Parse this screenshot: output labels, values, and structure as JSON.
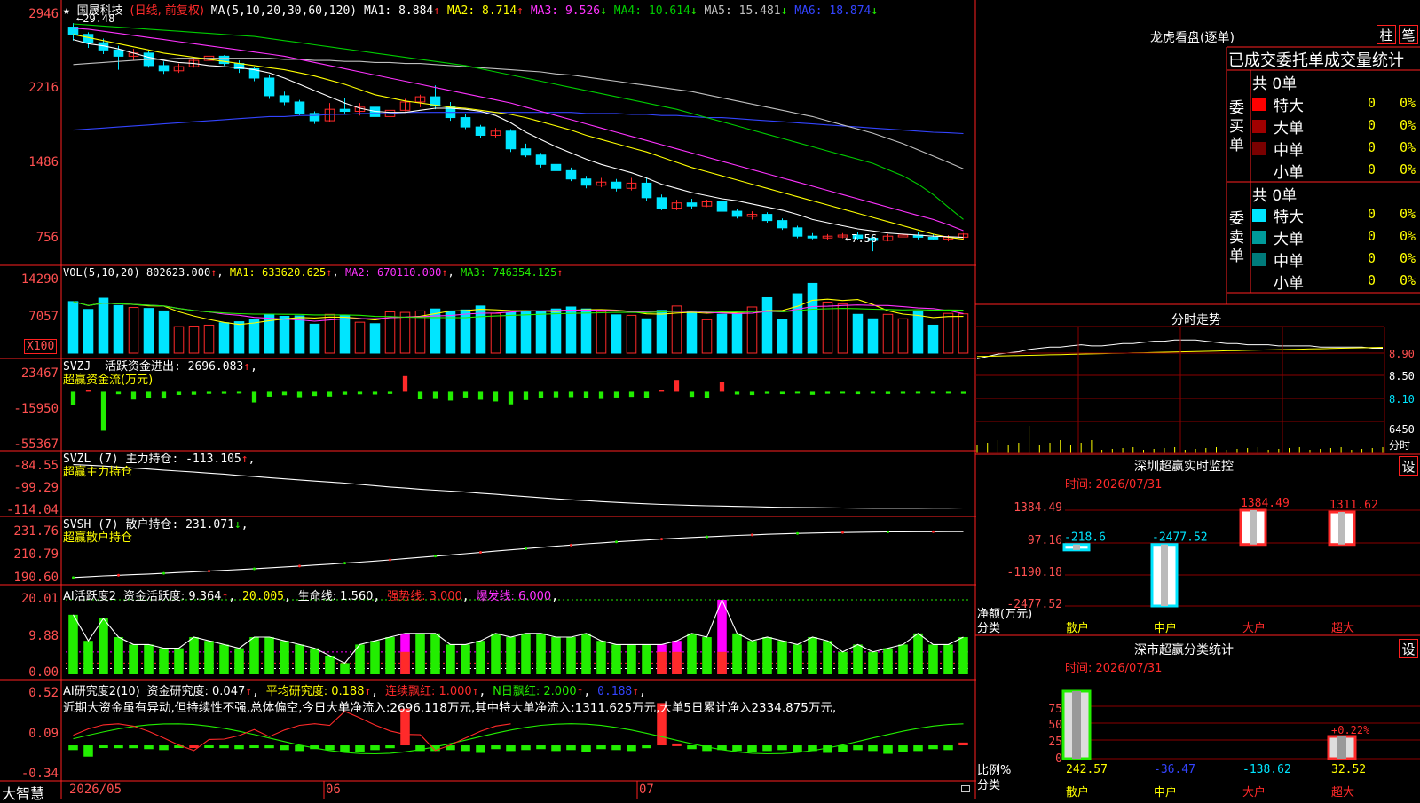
{
  "colors": {
    "up": "#ff2a2a",
    "down": "#00e5ff",
    "grid": "#8b0000",
    "border": "#ff2020",
    "axis": "#ff5050",
    "ma5": "#ffffff",
    "ma10": "#ffff00",
    "ma20": "#ff33ff",
    "ma30": "#00cc00",
    "ma60": "#c0c0c0",
    "ma120": "#3344ff",
    "green": "#22ee00",
    "magenta": "#ff00ff",
    "white": "#ffffff",
    "cyan": "#00e5ff"
  },
  "top_left": {
    "star": "★",
    "name": "国晟科技",
    "mode": "(日线, 前复权)",
    "ma_label": "MA(5,10,20,30,60,120)",
    "ma1": "MA1: 8.884",
    "ma2": "MA2: 8.714",
    "ma3": "MA3: 9.526",
    "ma4": "MA4: 10.614",
    "ma5": "MA5: 15.481",
    "ma6": "MA6: 18.874",
    "high_mark": "←29.48",
    "low_mark": "←7.56"
  },
  "price_axis": [
    "2946",
    "2216",
    "1486",
    "756"
  ],
  "vol_panel": {
    "title": "VOL(5,10,20)",
    "v": "802623.000",
    "ma1": "MA1: 633620.625",
    "ma2": "MA2: 670110.000",
    "ma3": "MA3: 746354.125",
    "axis": [
      "14290",
      "7057"
    ],
    "unit": "X100"
  },
  "svzj_panel": {
    "title": "SVZJ",
    "l1": "活跃资金进出: 2696.083",
    "l2": "超赢资金流(万元)",
    "axis": [
      "23467",
      "-15950",
      "-55367"
    ]
  },
  "svzl_panel": {
    "title": "SVZL (7)",
    "l1": "主力持仓: -113.105",
    "l2": "超赢主力持仓",
    "axis": [
      "-84.55",
      "-99.29",
      "-114.04"
    ]
  },
  "svsh_panel": {
    "title": "SVSH (7)",
    "l1": "散户持仓: 231.071",
    "l2": "超赢散户持仓",
    "axis": [
      "231.76",
      "210.79",
      "190.60"
    ]
  },
  "ai1_panel": {
    "title": "AI活跃度2",
    "l1": "资金活跃度: 9.364",
    "l2": "20.005",
    "l3": "生命线: 1.560",
    "l4": "强势线: 3.000",
    "l5": "爆发线: 6.000",
    "axis": [
      "20.01",
      "9.88",
      "0.00"
    ]
  },
  "ai2_panel": {
    "title": "AI研究度2(10)",
    "l1": "资金研究度: 0.047",
    "l2": "平均研究度: 0.188",
    "l3": "连续飘红: 1.000",
    "l4": "N日飘红: 2.000",
    "l5": "0.188",
    "comment": "近期大资金虽有异动,但持续性不强,总体偏空,今日大单净流入:2696.118万元,其中特大单净流入:1311.625万元,大单5日累计净入2334.875万元,",
    "axis": [
      "0.52",
      "0.09",
      "-0.34"
    ]
  },
  "date_axis": [
    "2026/05",
    "06",
    "07"
  ],
  "brand": "大智慧",
  "lhb": {
    "title": "龙虎看盘(逐单)",
    "btn1": "柱",
    "btn2": "笔",
    "subtitle": "已成交委托单成交量统计",
    "buy_label": "委买单",
    "sell_label": "委卖单",
    "buy_total": "共 0单",
    "sell_total": "共 0单",
    "rows": [
      {
        "name": "特大",
        "count": "0",
        "pct": "0%"
      },
      {
        "name": "大单",
        "count": "0",
        "pct": "0%"
      },
      {
        "name": "中单",
        "count": "0",
        "pct": "0%"
      },
      {
        "name": "小单",
        "count": "0",
        "pct": "0%"
      }
    ]
  },
  "intraday": {
    "title": "分时走势",
    "axis": [
      "8.90",
      "8.50",
      "8.10",
      "6450",
      "分时"
    ]
  },
  "monitor": {
    "title": "深圳超赢实时监控",
    "btn": "设",
    "date": "时间: 2026/07/31",
    "ylabel": "净额(万元)",
    "xlabel": "分类",
    "axis": [
      "1384.49",
      "97.16",
      "-1190.18",
      "-2477.52"
    ],
    "categories": [
      "散户",
      "中户",
      "大户",
      "超大"
    ],
    "values": [
      -218.6,
      -2477.52,
      1384.49,
      1311.62
    ],
    "value_labels": [
      "-218.6",
      "-2477.52",
      "1384.49",
      "1311.62"
    ]
  },
  "stats": {
    "title": "深市超赢分类统计",
    "btn": "设",
    "date": "时间: 2026/07/31",
    "ylabel": "比例%",
    "xlabel": "分类",
    "axis": [
      "75",
      "50",
      "25",
      "0"
    ],
    "categories": [
      "散户",
      "中户",
      "大户",
      "超大"
    ],
    "values": [
      242.57,
      -36.47,
      -138.62,
      32.52
    ],
    "value_labels": [
      "242.57",
      "-36.47",
      "-138.62",
      "32.52"
    ],
    "extra_label": "+0.22%"
  },
  "chart_data": {
    "type": "bar",
    "title": "国晟科技 日线 前复权",
    "candles": [
      [
        29.1,
        29.48,
        27.8,
        28.4
      ],
      [
        28.4,
        28.6,
        27.1,
        27.6
      ],
      [
        27.6,
        28.0,
        26.5,
        26.9
      ],
      [
        26.9,
        27.3,
        25.0,
        26.3
      ],
      [
        26.3,
        27.0,
        25.9,
        26.6
      ],
      [
        26.6,
        26.8,
        25.2,
        25.4
      ],
      [
        25.4,
        25.8,
        24.6,
        24.9
      ],
      [
        24.9,
        25.6,
        24.7,
        25.3
      ],
      [
        25.3,
        26.1,
        25.2,
        25.9
      ],
      [
        25.9,
        26.5,
        25.8,
        26.3
      ],
      [
        26.3,
        26.4,
        25.4,
        25.6
      ],
      [
        25.6,
        25.9,
        24.7,
        25.1
      ],
      [
        25.1,
        25.3,
        23.9,
        24.2
      ],
      [
        24.2,
        24.5,
        22.2,
        22.5
      ],
      [
        22.5,
        22.9,
        21.6,
        21.9
      ],
      [
        21.9,
        22.1,
        20.6,
        20.8
      ],
      [
        20.8,
        21.0,
        19.8,
        20.1
      ],
      [
        20.1,
        21.8,
        20.0,
        21.2
      ],
      [
        21.2,
        22.3,
        20.8,
        21.0
      ],
      [
        21.0,
        21.8,
        20.6,
        21.4
      ],
      [
        21.4,
        21.6,
        20.2,
        20.5
      ],
      [
        20.5,
        21.5,
        20.4,
        21.1
      ],
      [
        21.1,
        22.2,
        21.0,
        21.9
      ],
      [
        21.9,
        22.6,
        21.4,
        22.4
      ],
      [
        22.4,
        23.5,
        21.2,
        21.5
      ],
      [
        21.5,
        21.9,
        20.1,
        20.4
      ],
      [
        20.4,
        20.7,
        19.3,
        19.5
      ],
      [
        19.5,
        19.7,
        18.4,
        18.7
      ],
      [
        18.7,
        19.4,
        18.5,
        19.1
      ],
      [
        19.1,
        19.3,
        17.1,
        17.4
      ],
      [
        17.4,
        17.9,
        16.6,
        16.8
      ],
      [
        16.8,
        17.0,
        15.6,
        15.9
      ],
      [
        15.9,
        16.2,
        15.0,
        15.3
      ],
      [
        15.3,
        15.6,
        14.3,
        14.5
      ],
      [
        14.5,
        14.8,
        13.6,
        13.9
      ],
      [
        13.9,
        14.6,
        13.7,
        14.2
      ],
      [
        14.2,
        14.5,
        13.3,
        13.6
      ],
      [
        13.6,
        14.6,
        13.4,
        14.1
      ],
      [
        14.1,
        14.6,
        12.4,
        12.7
      ],
      [
        12.7,
        13.0,
        11.5,
        11.7
      ],
      [
        11.7,
        12.5,
        11.5,
        12.2
      ],
      [
        12.2,
        12.6,
        11.6,
        11.9
      ],
      [
        11.9,
        12.5,
        11.8,
        12.3
      ],
      [
        12.3,
        12.6,
        11.2,
        11.4
      ],
      [
        11.4,
        11.6,
        10.7,
        10.9
      ],
      [
        10.9,
        11.4,
        10.6,
        11.1
      ],
      [
        11.1,
        11.3,
        10.3,
        10.5
      ],
      [
        10.5,
        10.7,
        9.6,
        9.8
      ],
      [
        9.8,
        10.0,
        8.8,
        9.0
      ],
      [
        9.0,
        9.3,
        8.7,
        8.9
      ],
      [
        8.9,
        9.2,
        8.6,
        9.0
      ],
      [
        9.0,
        9.3,
        8.8,
        9.1
      ],
      [
        9.1,
        9.4,
        8.6,
        8.8
      ],
      [
        8.8,
        9.0,
        7.56,
        8.6
      ],
      [
        8.6,
        9.2,
        8.5,
        9.0
      ],
      [
        9.0,
        9.5,
        8.9,
        9.1
      ],
      [
        9.1,
        9.4,
        8.7,
        8.9
      ],
      [
        8.9,
        9.2,
        8.6,
        8.8
      ],
      [
        8.8,
        9.1,
        8.5,
        8.9
      ],
      [
        8.9,
        9.3,
        8.6,
        9.2
      ]
    ],
    "ma5": [
      27.9,
      27.5,
      27.3,
      27.0,
      26.6,
      26.2,
      25.9,
      25.7,
      25.6,
      25.4,
      25.3,
      25.2,
      25.0,
      24.7,
      24.2,
      23.6,
      23.0,
      22.4,
      21.8,
      21.3,
      21.0,
      20.9,
      20.9,
      21.1,
      21.3,
      21.3,
      21.2,
      21.0,
      20.6,
      19.9,
      19.0,
      18.3,
      17.6,
      17.0,
      16.4,
      15.9,
      15.5,
      15.1,
      14.6,
      14.0,
      13.6,
      13.2,
      12.9,
      12.6,
      12.4,
      12.1,
      11.8,
      11.5,
      11.1,
      10.6,
      10.3,
      10.0,
      9.7,
      9.5,
      9.3,
      9.2,
      9.1,
      9.0,
      8.95,
      8.88
    ],
    "ma10": [
      28.4,
      28.1,
      27.8,
      27.5,
      27.2,
      26.9,
      26.6,
      26.4,
      26.2,
      26.0,
      25.8,
      25.6,
      25.4,
      25.2,
      25.0,
      24.7,
      24.4,
      24.0,
      23.6,
      23.1,
      22.6,
      22.3,
      22.0,
      21.8,
      21.6,
      21.4,
      21.3,
      21.1,
      20.9,
      20.7,
      20.4,
      20.0,
      19.6,
      19.2,
      18.7,
      18.3,
      17.9,
      17.5,
      17.1,
      16.6,
      16.1,
      15.6,
      15.2,
      14.8,
      14.4,
      14.0,
      13.6,
      13.2,
      12.8,
      12.4,
      12.0,
      11.6,
      11.2,
      10.8,
      10.4,
      10.0,
      9.6,
      9.2,
      8.9,
      8.71
    ],
    "ma20": [
      29.0,
      28.9,
      28.7,
      28.5,
      28.3,
      28.1,
      27.9,
      27.7,
      27.5,
      27.3,
      27.1,
      26.9,
      26.7,
      26.5,
      26.3,
      26.0,
      25.7,
      25.4,
      25.1,
      24.8,
      24.5,
      24.2,
      23.9,
      23.6,
      23.3,
      23.0,
      22.7,
      22.4,
      22.1,
      21.8,
      21.4,
      21.0,
      20.6,
      20.2,
      19.8,
      19.4,
      19.0,
      18.6,
      18.2,
      17.8,
      17.4,
      17.0,
      16.6,
      16.2,
      15.8,
      15.4,
      15.0,
      14.6,
      14.2,
      13.8,
      13.4,
      13.0,
      12.6,
      12.2,
      11.8,
      11.4,
      11.0,
      10.6,
      10.1,
      9.53
    ],
    "ma30": [
      29.4,
      29.3,
      29.2,
      29.1,
      29.0,
      28.9,
      28.8,
      28.7,
      28.6,
      28.5,
      28.4,
      28.3,
      28.2,
      28.0,
      27.8,
      27.6,
      27.4,
      27.2,
      27.0,
      26.8,
      26.6,
      26.4,
      26.2,
      26.0,
      25.8,
      25.6,
      25.4,
      25.1,
      24.8,
      24.5,
      24.2,
      23.9,
      23.6,
      23.3,
      23.0,
      22.7,
      22.4,
      22.1,
      21.8,
      21.5,
      21.2,
      20.8,
      20.4,
      20.0,
      19.6,
      19.2,
      18.8,
      18.4,
      18.0,
      17.6,
      17.2,
      16.8,
      16.4,
      16.0,
      15.4,
      14.8,
      14.0,
      13.0,
      11.8,
      10.61
    ],
    "ma60": [
      25.5,
      25.6,
      25.7,
      25.8,
      25.9,
      26.0,
      26.0,
      26.1,
      26.1,
      26.1,
      26.1,
      26.1,
      26.1,
      26.1,
      26.0,
      26.0,
      25.9,
      25.9,
      25.8,
      25.8,
      25.7,
      25.7,
      25.6,
      25.6,
      25.5,
      25.4,
      25.3,
      25.2,
      25.1,
      25.0,
      24.9,
      24.8,
      24.6,
      24.5,
      24.3,
      24.1,
      23.9,
      23.7,
      23.5,
      23.3,
      23.1,
      22.9,
      22.6,
      22.3,
      22.0,
      21.7,
      21.4,
      21.1,
      20.8,
      20.5,
      20.1,
      19.7,
      19.3,
      18.9,
      18.4,
      17.9,
      17.3,
      16.7,
      16.1,
      15.48
    ],
    "ma120": [
      19.2,
      19.3,
      19.4,
      19.5,
      19.6,
      19.7,
      19.8,
      19.9,
      20.0,
      20.1,
      20.2,
      20.3,
      20.4,
      20.5,
      20.5,
      20.6,
      20.6,
      20.7,
      20.7,
      20.8,
      20.8,
      20.8,
      20.9,
      20.9,
      20.9,
      20.9,
      20.9,
      20.9,
      20.9,
      20.9,
      20.9,
      20.9,
      20.9,
      20.9,
      20.8,
      20.8,
      20.8,
      20.7,
      20.7,
      20.6,
      20.6,
      20.5,
      20.4,
      20.4,
      20.3,
      20.2,
      20.1,
      20.0,
      19.9,
      19.8,
      19.7,
      19.6,
      19.5,
      19.4,
      19.3,
      19.2,
      19.1,
      19.0,
      18.95,
      18.87
    ],
    "volume": [
      10500,
      8900,
      11200,
      9700,
      9300,
      9100,
      8600,
      5400,
      5500,
      5700,
      6200,
      6400,
      6900,
      7900,
      7500,
      7600,
      5900,
      7900,
      7700,
      6300,
      6000,
      8400,
      8300,
      8600,
      9000,
      8600,
      8800,
      9600,
      8100,
      8300,
      8400,
      8500,
      9000,
      9400,
      9000,
      8500,
      7800,
      7700,
      7000,
      8700,
      9600,
      8600,
      6800,
      7900,
      8000,
      9400,
      11300,
      6900,
      12100,
      14200,
      10400,
      10000,
      7900,
      7000,
      7900,
      7000,
      8600,
      5700,
      8100,
      8000
    ],
    "svzj": [
      -14000,
      1800,
      -40000,
      -2500,
      -8000,
      -6800,
      -7000,
      -3200,
      -3000,
      -2100,
      -2000,
      -1800,
      -11000,
      -5000,
      -3500,
      -5600,
      -4300,
      -4900,
      -3000,
      -2600,
      -2800,
      -2200,
      16000,
      -7800,
      -7400,
      -9100,
      -5900,
      -8200,
      -10000,
      -13000,
      -8500,
      -6100,
      -5700,
      -5500,
      -6400,
      -7400,
      -5900,
      -5200,
      -6000,
      2000,
      12000,
      -5200,
      -6800,
      10000,
      -2800,
      -3300,
      -2000,
      -2400,
      -1800,
      -3100,
      -2000,
      -1500,
      -2400,
      -1700,
      -2200,
      -1900,
      -1600,
      -1700,
      -1500,
      -2000
    ],
    "svzl": [
      -86.0,
      -86.4,
      -86.9,
      -87.5,
      -88.2,
      -88.8,
      -89.5,
      -90.1,
      -90.7,
      -91.4,
      -92.0,
      -92.8,
      -93.5,
      -94.2,
      -94.9,
      -95.6,
      -96.3,
      -96.9,
      -97.6,
      -98.4,
      -99.2,
      -100.0,
      -100.7,
      -101.4,
      -102.0,
      -102.6,
      -103.2,
      -103.9,
      -104.6,
      -105.3,
      -106.0,
      -106.7,
      -107.4,
      -108.0,
      -108.5,
      -109.1,
      -109.6,
      -110.1,
      -110.5,
      -110.9,
      -111.2,
      -111.5,
      -111.7,
      -111.9,
      -112.1,
      -112.3,
      -112.5,
      -112.7,
      -112.8,
      -112.9,
      -113.0,
      -113.1,
      -113.2,
      -113.3,
      -113.3,
      -113.3,
      -113.3,
      -113.2,
      -113.2,
      -113.1
    ],
    "svsh": [
      190.9,
      191.6,
      192.3,
      192.9,
      193.4,
      194.0,
      194.6,
      195.3,
      195.9,
      196.5,
      197.2,
      197.9,
      198.6,
      199.4,
      200.2,
      201.0,
      201.8,
      202.6,
      203.5,
      204.4,
      205.3,
      206.3,
      207.4,
      208.5,
      209.6,
      210.7,
      211.8,
      212.9,
      214.0,
      215.1,
      216.2,
      217.3,
      218.3,
      219.3,
      220.3,
      221.2,
      222.1,
      222.9,
      223.7,
      224.5,
      225.2,
      225.9,
      226.5,
      227.1,
      227.7,
      228.2,
      228.7,
      229.1,
      229.5,
      229.8,
      230.1,
      230.3,
      230.5,
      230.7,
      230.8,
      230.9,
      231.0,
      231.0,
      231.1,
      231.07
    ],
    "ai_active": [
      16,
      9,
      15,
      10,
      8,
      8,
      7,
      7,
      10,
      9,
      8,
      7,
      10,
      10,
      9,
      8,
      7,
      5,
      3,
      8,
      9,
      10,
      11,
      11,
      11,
      8,
      8,
      9,
      11,
      10,
      11,
      11,
      10,
      10,
      11,
      9,
      8,
      8,
      8,
      8,
      9,
      11,
      10,
      20,
      11,
      9,
      10,
      9,
      8,
      10,
      9,
      6,
      8,
      6,
      7,
      8,
      11,
      8,
      8,
      10
    ],
    "ai_highlight": [
      false,
      false,
      false,
      false,
      false,
      false,
      false,
      false,
      false,
      false,
      false,
      false,
      false,
      false,
      false,
      false,
      false,
      false,
      false,
      false,
      false,
      false,
      true,
      false,
      false,
      false,
      false,
      false,
      false,
      false,
      false,
      false,
      false,
      false,
      false,
      false,
      false,
      false,
      false,
      true,
      true,
      false,
      false,
      true,
      false,
      false,
      false,
      false,
      false,
      false,
      false,
      false,
      false,
      false,
      false,
      false,
      false,
      false,
      false,
      false
    ],
    "ai_research": [
      -0.05,
      -0.12,
      -0.02,
      -0.03,
      -0.03,
      -0.04,
      -0.05,
      -0.02,
      0.0,
      -0.02,
      -0.03,
      -0.04,
      -0.02,
      -0.03,
      -0.05,
      -0.06,
      -0.04,
      -0.05,
      -0.07,
      -0.07,
      -0.05,
      -0.03,
      0.39,
      -0.06,
      -0.06,
      -0.05,
      -0.06,
      -0.08,
      -0.04,
      -0.06,
      -0.05,
      -0.04,
      -0.06,
      -0.05,
      -0.07,
      -0.04,
      -0.05,
      -0.06,
      -0.03,
      0.45,
      0.02,
      -0.04,
      -0.06,
      -0.05,
      -0.06,
      -0.07,
      -0.06,
      -0.05,
      -0.07,
      -0.06,
      -0.08,
      -0.07,
      -0.05,
      -0.06,
      -0.09,
      -0.07,
      -0.06,
      -0.04,
      -0.05,
      0.03
    ],
    "intraday_price": [
      8.78,
      8.8,
      8.82,
      8.83,
      8.84,
      8.86,
      8.87,
      8.88,
      8.88,
      8.89,
      8.9,
      8.89,
      8.89,
      8.9,
      8.91,
      8.91,
      8.92,
      8.93,
      8.93,
      8.94,
      8.94,
      8.94,
      8.93,
      8.92,
      8.91,
      8.91,
      8.9,
      8.9,
      8.9,
      8.89,
      8.89,
      8.89,
      8.89,
      8.88,
      8.88,
      8.88,
      8.88,
      8.88,
      8.87,
      8.87
    ]
  }
}
